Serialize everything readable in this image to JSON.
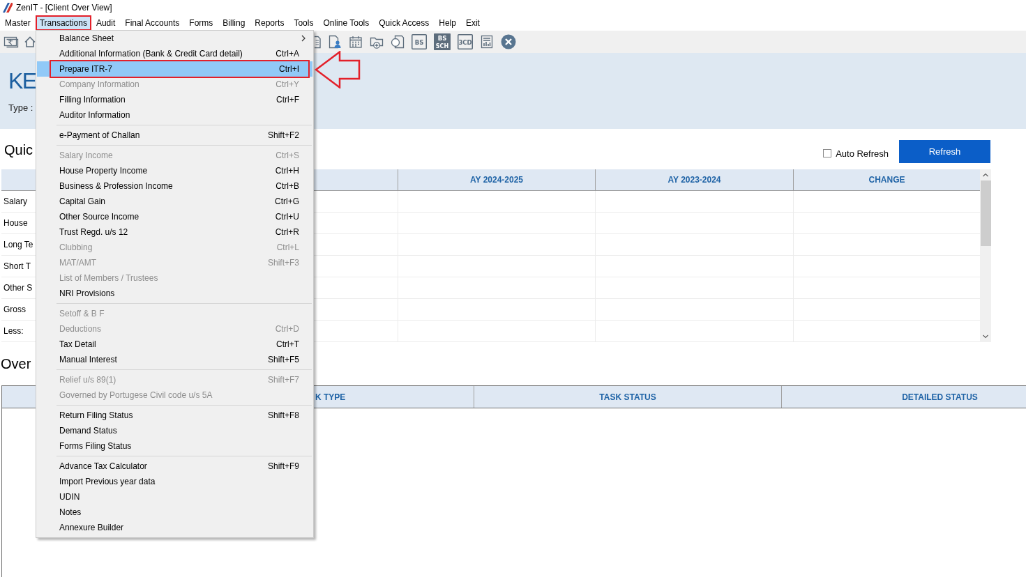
{
  "window": {
    "title": "ZenIT - [Client Over View]"
  },
  "menu_bar": [
    {
      "label": "Master",
      "selected": false,
      "annotated": false
    },
    {
      "label": "Transactions",
      "selected": true,
      "annotated": true
    },
    {
      "label": "Audit",
      "selected": false,
      "annotated": false
    },
    {
      "label": "Final Accounts",
      "selected": false,
      "annotated": false
    },
    {
      "label": "Forms",
      "selected": false,
      "annotated": false
    },
    {
      "label": "Billing",
      "selected": false,
      "annotated": false
    },
    {
      "label": "Reports",
      "selected": false,
      "annotated": false
    },
    {
      "label": "Tools",
      "selected": false,
      "annotated": false
    },
    {
      "label": "Online Tools",
      "selected": false,
      "annotated": false
    },
    {
      "label": "Quick Access",
      "selected": false,
      "annotated": false
    },
    {
      "label": "Help",
      "selected": false,
      "annotated": false
    },
    {
      "label": "Exit",
      "selected": false,
      "annotated": false
    }
  ],
  "toolbar": {
    "tagged_icons": [
      {
        "text": "BS"
      },
      {
        "text": "BS",
        "subtext": "SCH"
      },
      {
        "text": "3CD"
      }
    ]
  },
  "client_header": {
    "name": "KE",
    "type_label": "Type :"
  },
  "quick_section": {
    "title": "Quic",
    "auto_refresh": {
      "label": "Auto Refresh",
      "checked": false
    },
    "refresh_button": "Refresh",
    "table": {
      "columns": [
        "AY 2024-2025",
        "AY 2023-2024",
        "CHANGE"
      ],
      "rows": [
        {
          "label": "Salary"
        },
        {
          "label": "House"
        },
        {
          "label": "Long Te"
        },
        {
          "label": "Short T"
        },
        {
          "label": "Other S"
        },
        {
          "label": "Gross"
        },
        {
          "label": "Less:"
        }
      ]
    }
  },
  "overview_section": {
    "title": "Over",
    "table": {
      "columns": [
        "K TYPE",
        "TASK STATUS",
        "DETAILED STATUS"
      ]
    }
  },
  "transactions_menu": {
    "items": [
      {
        "kind": "item",
        "label": "Balance Sheet",
        "submenu": true,
        "selected": false,
        "disabled": false
      },
      {
        "kind": "item",
        "label": "Additional Information (Bank & Credit Card detail)",
        "shortcut": "Ctrl+A",
        "selected": false,
        "disabled": false
      },
      {
        "kind": "item",
        "label": "Prepare ITR-7",
        "shortcut": "Ctrl+I",
        "selected": true,
        "disabled": false,
        "annotated": true,
        "pointer_arrow": true
      },
      {
        "kind": "item",
        "label": "Company Information",
        "shortcut": "Ctrl+Y",
        "selected": false,
        "disabled": true
      },
      {
        "kind": "item",
        "label": "Filling Information",
        "shortcut": "Ctrl+F",
        "selected": false,
        "disabled": false
      },
      {
        "kind": "item",
        "label": "Auditor Information",
        "selected": false,
        "disabled": false
      },
      {
        "kind": "separator"
      },
      {
        "kind": "item",
        "label": "e-Payment of Challan",
        "shortcut": "Shift+F2",
        "selected": false,
        "disabled": false
      },
      {
        "kind": "separator"
      },
      {
        "kind": "item",
        "label": "Salary Income",
        "shortcut": "Ctrl+S",
        "selected": false,
        "disabled": true
      },
      {
        "kind": "item",
        "label": "House Property Income",
        "shortcut": "Ctrl+H",
        "selected": false,
        "disabled": false
      },
      {
        "kind": "item",
        "label": "Business & Profession Income",
        "shortcut": "Ctrl+B",
        "selected": false,
        "disabled": false
      },
      {
        "kind": "item",
        "label": "Capital Gain",
        "shortcut": "Ctrl+G",
        "selected": false,
        "disabled": false
      },
      {
        "kind": "item",
        "label": "Other Source Income",
        "shortcut": "Ctrl+U",
        "selected": false,
        "disabled": false
      },
      {
        "kind": "item",
        "label": "Trust Regd. u/s 12",
        "shortcut": "Ctrl+R",
        "selected": false,
        "disabled": false
      },
      {
        "kind": "item",
        "label": "Clubbing",
        "shortcut": "Ctrl+L",
        "selected": false,
        "disabled": true
      },
      {
        "kind": "item",
        "label": "MAT/AMT",
        "shortcut": "Shift+F3",
        "selected": false,
        "disabled": true
      },
      {
        "kind": "item",
        "label": "List of Members / Trustees",
        "selected": false,
        "disabled": true
      },
      {
        "kind": "item",
        "label": "NRI Provisions",
        "selected": false,
        "disabled": false
      },
      {
        "kind": "separator"
      },
      {
        "kind": "item",
        "label": "Setoff & B F",
        "selected": false,
        "disabled": true
      },
      {
        "kind": "item",
        "label": "Deductions",
        "shortcut": "Ctrl+D",
        "selected": false,
        "disabled": true
      },
      {
        "kind": "item",
        "label": "Tax Detail",
        "shortcut": "Ctrl+T",
        "selected": false,
        "disabled": false
      },
      {
        "kind": "item",
        "label": "Manual Interest",
        "shortcut": "Shift+F5",
        "selected": false,
        "disabled": false
      },
      {
        "kind": "separator"
      },
      {
        "kind": "item",
        "label": "Relief u/s 89(1)",
        "shortcut": "Shift+F7",
        "selected": false,
        "disabled": true
      },
      {
        "kind": "item",
        "label": "Governed by Portugese Civil code u/s 5A",
        "selected": false,
        "disabled": true
      },
      {
        "kind": "separator"
      },
      {
        "kind": "item",
        "label": "Return Filing Status",
        "shortcut": "Shift+F8",
        "selected": false,
        "disabled": false
      },
      {
        "kind": "item",
        "label": "Demand Status",
        "selected": false,
        "disabled": false
      },
      {
        "kind": "item",
        "label": "Forms Filing Status",
        "selected": false,
        "disabled": false
      },
      {
        "kind": "separator"
      },
      {
        "kind": "item",
        "label": "Advance Tax Calculator",
        "shortcut": "Shift+F9",
        "selected": false,
        "disabled": false
      },
      {
        "kind": "item",
        "label": "Import Previous year data",
        "selected": false,
        "disabled": false
      },
      {
        "kind": "item",
        "label": "UDIN",
        "selected": false,
        "disabled": false
      },
      {
        "kind": "item",
        "label": "Notes",
        "selected": false,
        "disabled": false
      },
      {
        "kind": "item",
        "label": "Annexure Builder",
        "selected": false,
        "disabled": false
      }
    ]
  }
}
